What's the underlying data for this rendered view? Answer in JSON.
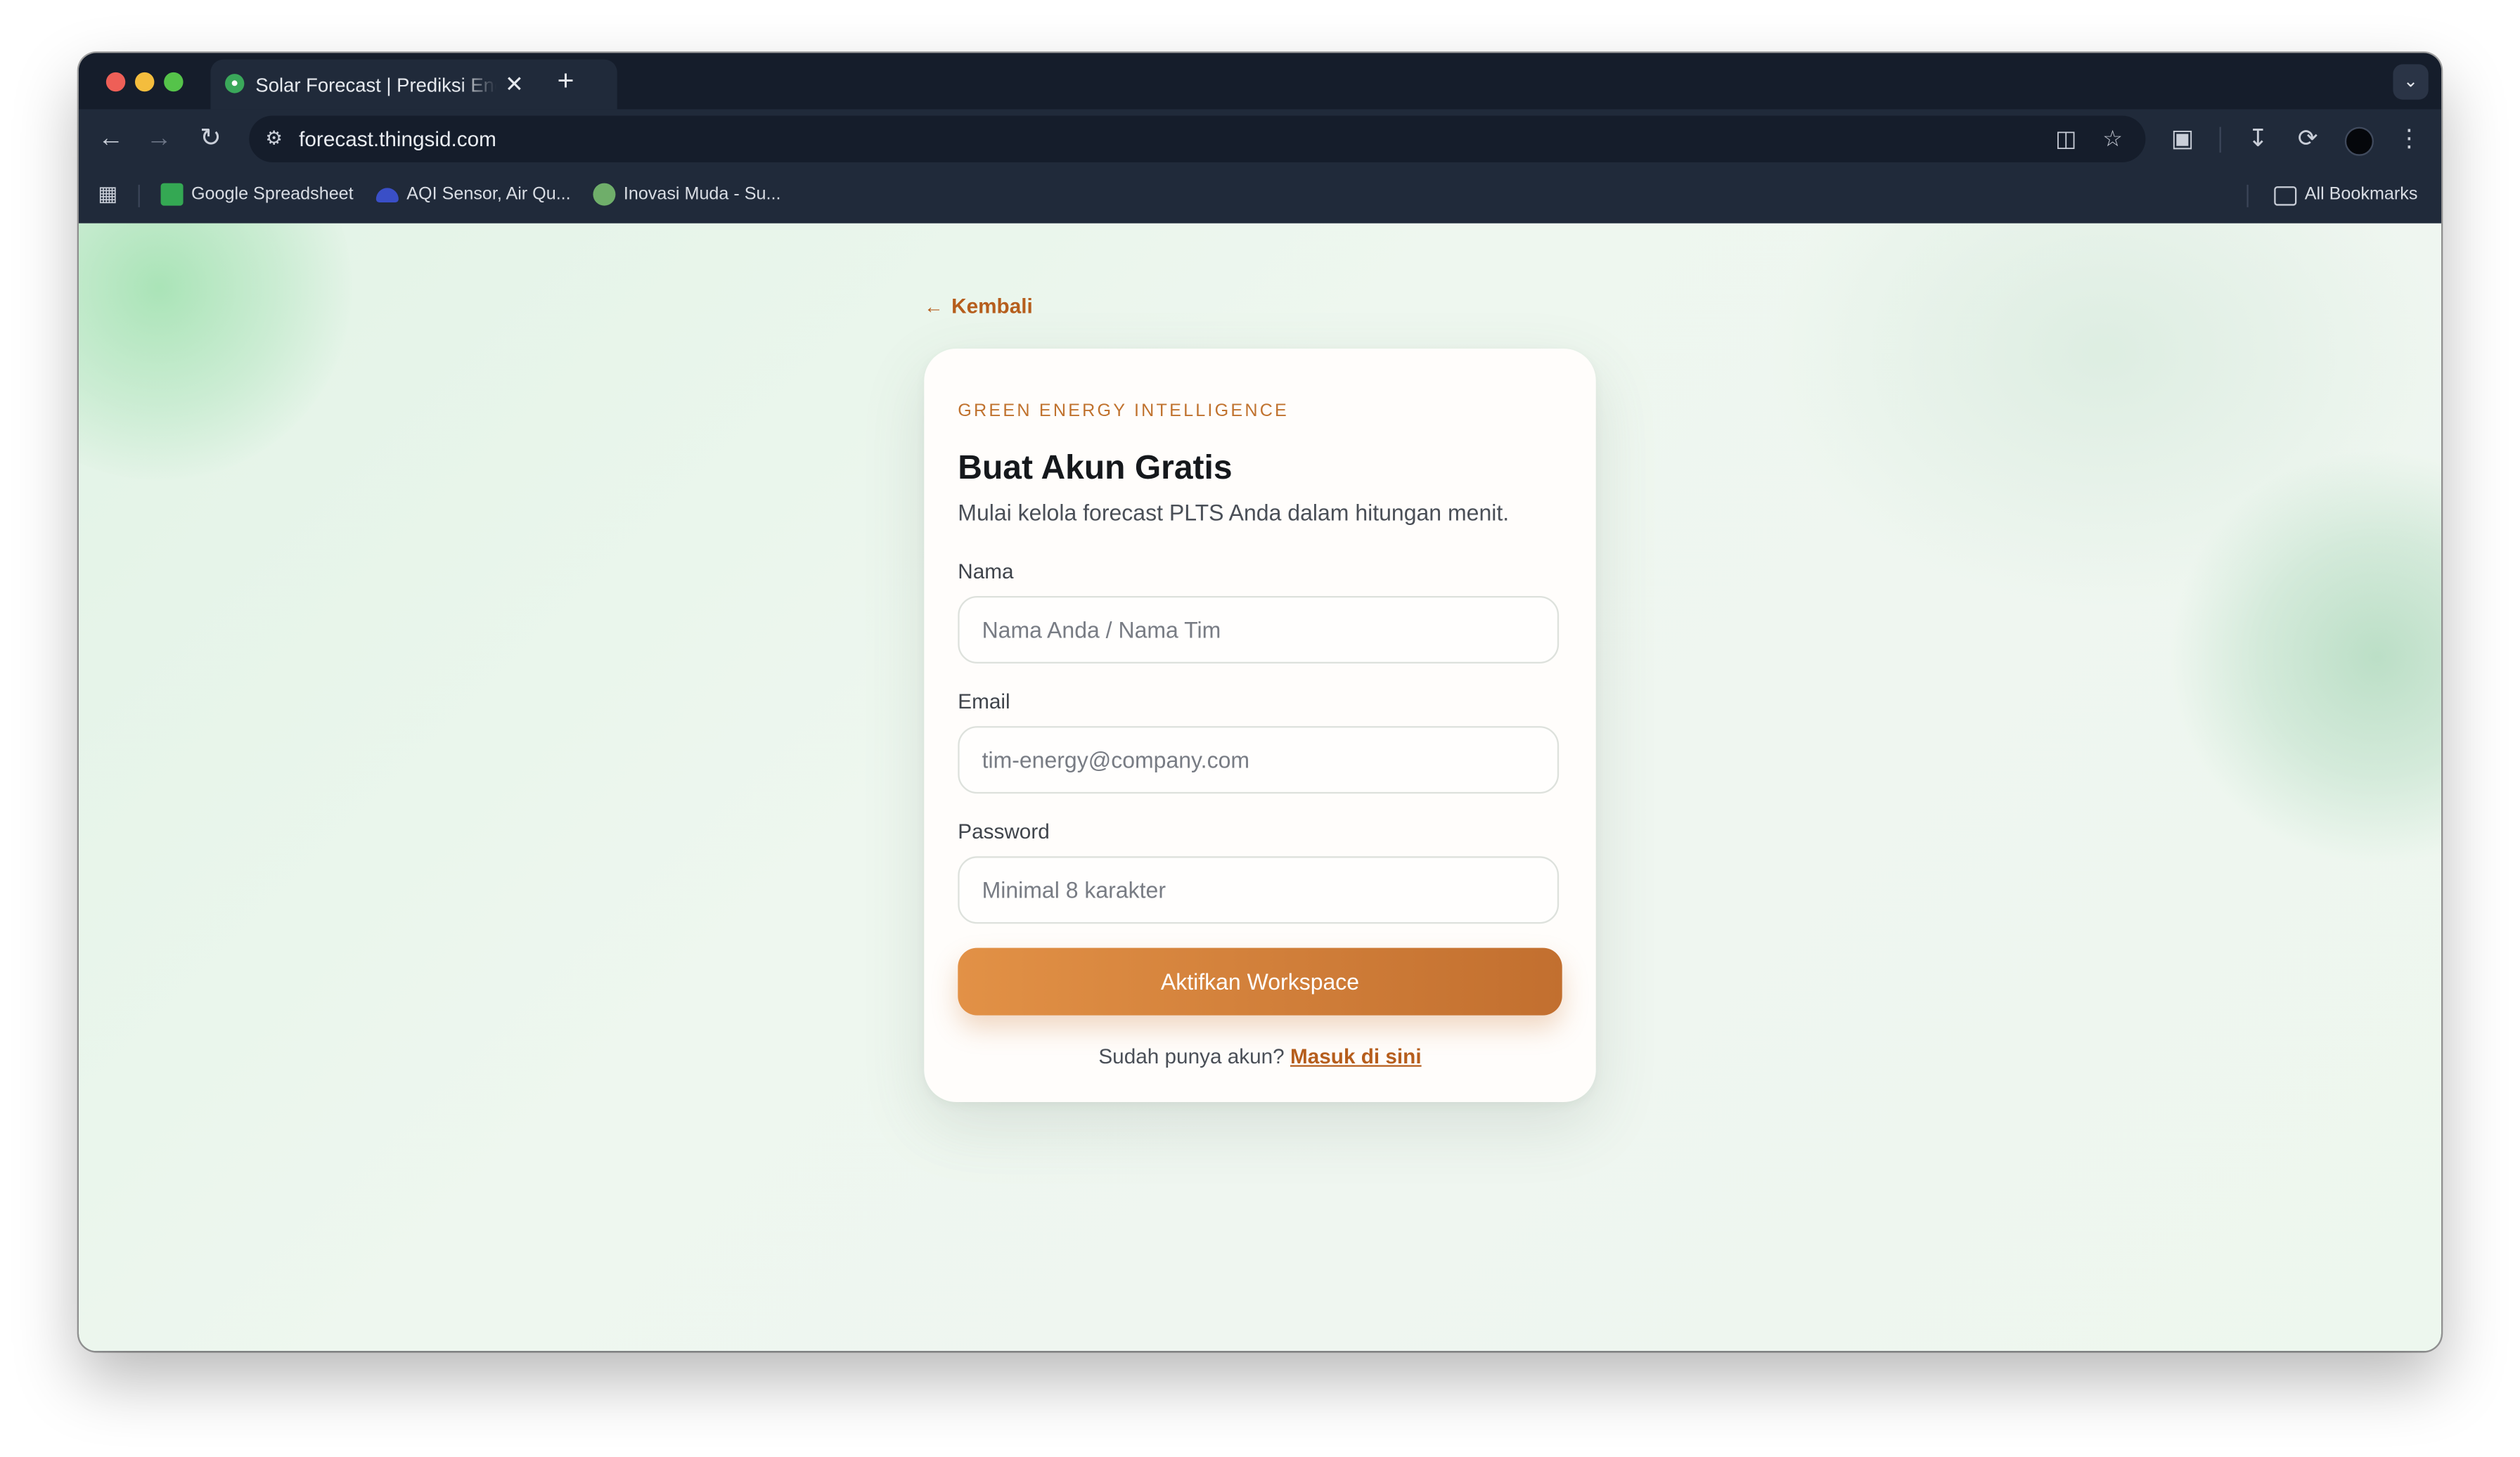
{
  "browser": {
    "tab_title": "Solar Forecast | Prediksi Energi Surya",
    "tab_close_glyph": "✕",
    "new_tab_glyph": "+",
    "tab_menu_glyph": "⌄",
    "url": "forecast.thingsid.com",
    "bookmarks": [
      {
        "label": "Google Spreadsheet",
        "icon": "google-sheets-icon",
        "color": "#34a853"
      },
      {
        "label": "AQI Sensor, Air Qu...",
        "icon": "aqi-sensor-icon",
        "color": "#3a4fc7"
      },
      {
        "label": "Inovasi Muda - Su...",
        "icon": "inovasi-muda-icon",
        "color": "#6fae6a"
      }
    ],
    "all_bookmarks_label": "All Bookmarks"
  },
  "page": {
    "back_label": "Kembali",
    "kicker": "GREEN ENERGY INTELLIGENCE",
    "title": "Buat Akun Gratis",
    "subtitle": "Mulai kelola forecast PLTS Anda dalam hitungan menit.",
    "fields": [
      {
        "label": "Nama",
        "placeholder": "Nama Anda / Nama Tim",
        "value": ""
      },
      {
        "label": "Email",
        "placeholder": "tim-energy@company.com",
        "value": ""
      },
      {
        "label": "Password",
        "placeholder": "Minimal 8 karakter",
        "value": ""
      }
    ],
    "submit_label": "Aktifkan Workspace",
    "footer_text": "Sudah punya akun?",
    "signin_label": "Masuk di sini"
  },
  "colors": {
    "accent": "#c0722e",
    "button_gradient_start": "#e29146",
    "button_gradient_end": "#c26f2f",
    "link": "#b65e1d",
    "browser_chrome": "#202a3a",
    "page_background": "#e8f5ea"
  }
}
